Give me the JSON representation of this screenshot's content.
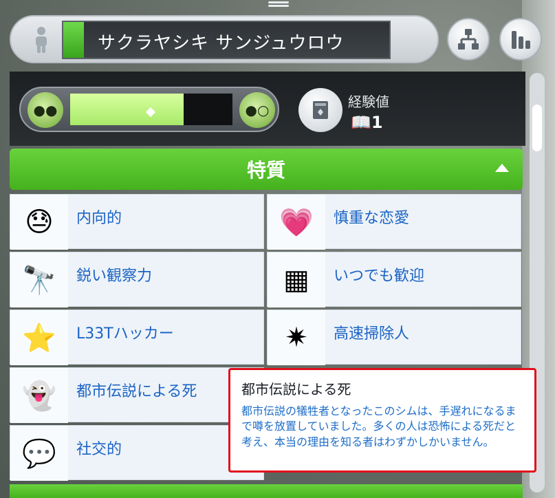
{
  "header": {
    "sim_name": "サクラヤシキ サンジュウロウ",
    "icons": [
      "sim-silhouette-icon",
      "family-tree-icon",
      "stats-icon"
    ]
  },
  "mood": {
    "fill_fraction": 0.7,
    "left_icon": "ghost-mood-icon",
    "right_icon": "ghost-mood-icon"
  },
  "experience": {
    "label": "経験値",
    "value": "1",
    "icon": "book-icon"
  },
  "traits_section": {
    "title": "特質",
    "toggle_icon": "caret-up-icon",
    "traits": [
      {
        "label": "内向的",
        "icon": "sweating-emoji-icon"
      },
      {
        "label": "慎重な恋愛",
        "icon": "heart-in-jar-icon"
      },
      {
        "label": "鋭い観察力",
        "icon": "binoculars-icon"
      },
      {
        "label": "いつでも歓迎",
        "icon": "welcome-mat-icon"
      },
      {
        "label": "L33Tハッカー",
        "icon": "computer-star-icon"
      },
      {
        "label": "高速掃除人",
        "icon": "feather-duster-icon"
      },
      {
        "label": "都市伝説による死",
        "icon": "ghost-scythe-icon"
      },
      {
        "label": "社交的",
        "icon": "chatting-mouths-icon"
      }
    ]
  },
  "tooltip": {
    "title": "都市伝説による死",
    "body": "都市伝説の犠牲者となったこのシムは、手遅れになるまで噂を放置していました。多くの人は恐怖による死だと考え、本当の理由を知る者はわずかしかいません。"
  },
  "colors": {
    "accent_green": "#4fbe25",
    "trait_text_blue": "#1b64c4",
    "tooltip_border": "#e0101b"
  }
}
